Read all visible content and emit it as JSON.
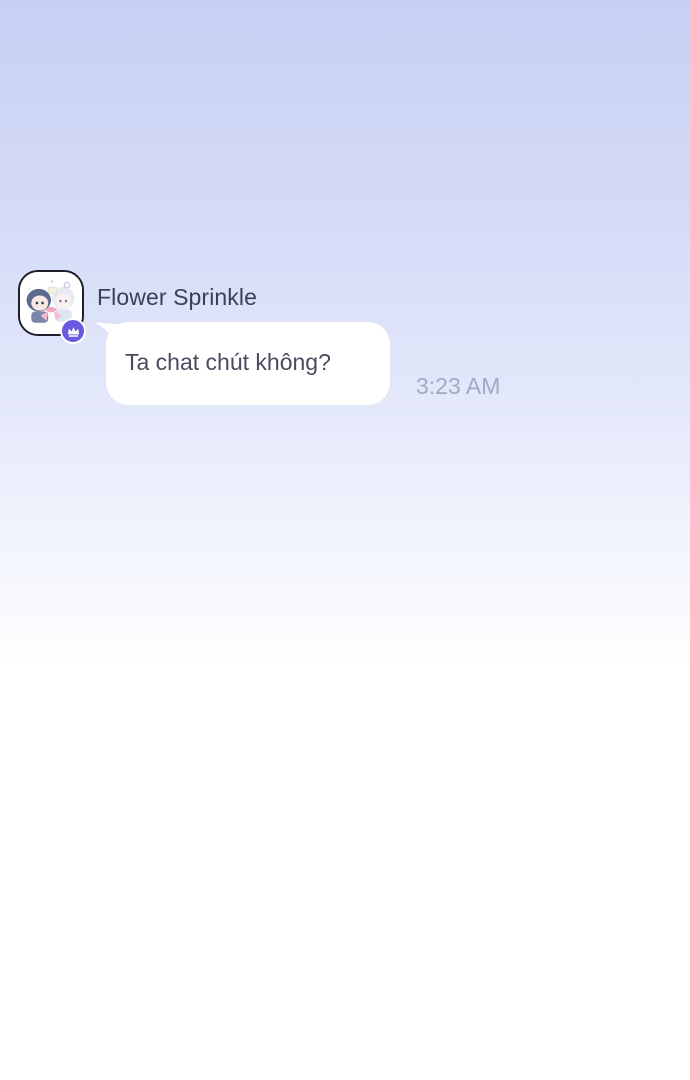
{
  "conversation": {
    "message": {
      "sender_name": "Flower Sprinkle",
      "text": "Ta chat chút không?",
      "time": "3:23 AM",
      "avatar_icon": "profile-avatar",
      "badge_icon": "crown-icon"
    }
  },
  "colors": {
    "badge": "#6a5ae0",
    "bubble": "#ffffff",
    "background_top": "#c7d0f3",
    "background_bottom": "#ffffff"
  }
}
